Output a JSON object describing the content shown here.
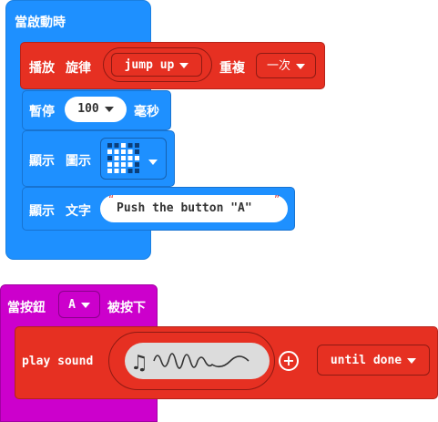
{
  "script1": {
    "hat_label": "當啟動時",
    "play_block": {
      "label1": "播放",
      "label2": "旋律",
      "melody": "jump up",
      "repeat_label": "重複",
      "repeat_value": "一次"
    },
    "pause_block": {
      "label": "暫停",
      "ms_value": "100",
      "unit": "毫秒"
    },
    "show_icon_block": {
      "label1": "顯示",
      "label2": "圖示"
    },
    "show_string_block": {
      "label1": "顯示",
      "label2": "文字",
      "text": "Push the button \"A\"",
      "quote_open": "“",
      "quote_close": "”"
    }
  },
  "script2": {
    "hat_label1": "當按鈕",
    "button_value": "A",
    "hat_label2": "被按下",
    "play_sound_block": {
      "label": "play sound",
      "mode": "until done"
    }
  },
  "colors": {
    "basic_blue": "#1e90ff",
    "music_red": "#e63022",
    "input_magenta": "#cc00cc"
  },
  "icons": {
    "led_grid": [
      [
        0,
        0,
        1,
        0,
        0
      ],
      [
        1,
        1,
        1,
        1,
        0
      ],
      [
        0,
        1,
        1,
        1,
        1
      ],
      [
        1,
        1,
        1,
        1,
        0
      ],
      [
        1,
        1,
        1,
        0,
        0
      ]
    ]
  }
}
